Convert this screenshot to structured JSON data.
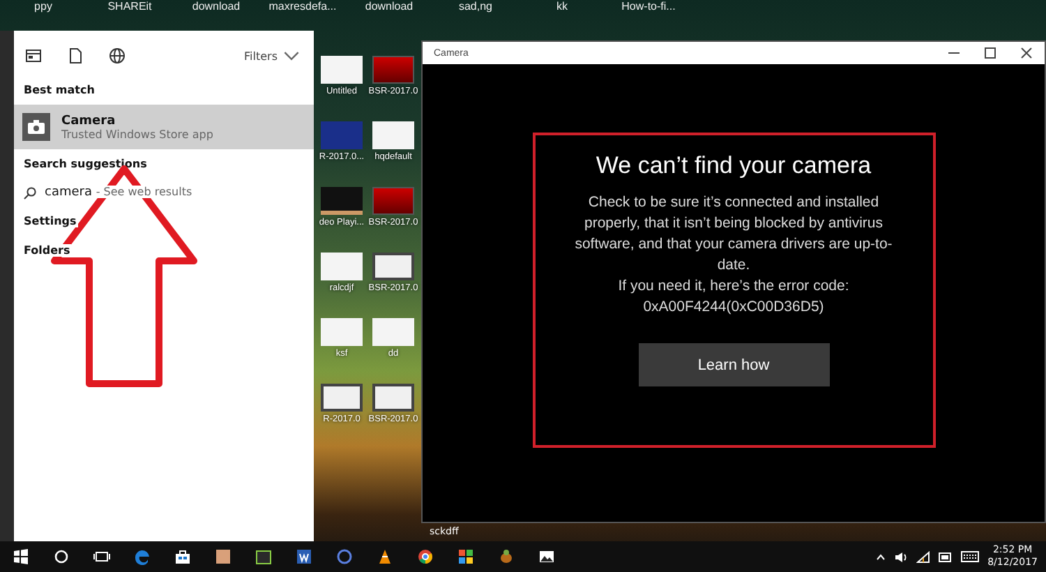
{
  "desktop": {
    "top_labels": [
      "ppy",
      "SHAREit",
      "download",
      "maxresdefa...",
      "download",
      "sad,ng",
      "kk",
      "How-to-fi..."
    ],
    "icons": [
      {
        "label": "Untitled",
        "kind": "doc"
      },
      {
        "label": "BSR-2017.0",
        "kind": "red"
      },
      {
        "label": "R-2017.0...",
        "kind": "blue"
      },
      {
        "label": "hqdefault",
        "kind": "doc"
      },
      {
        "label": "deo Playi...",
        "kind": "dark"
      },
      {
        "label": "BSR-2017.0",
        "kind": "red"
      },
      {
        "label": "ralcdjf",
        "kind": "doc"
      },
      {
        "label": "BSR-2017.0",
        "kind": "film"
      },
      {
        "label": "ksf",
        "kind": "doc"
      },
      {
        "label": "dd",
        "kind": "doc"
      },
      {
        "label": "R-2017.0",
        "kind": "film"
      },
      {
        "label": "BSR-2017.0",
        "kind": "film"
      }
    ],
    "stray_label": "sckdff"
  },
  "start_menu": {
    "filters": "Filters",
    "best_match_heading": "Best match",
    "result": {
      "title": "Camera",
      "subtitle": "Trusted Windows Store app",
      "selected": true
    },
    "suggestions_heading": "Search suggestions",
    "suggestion": {
      "query": "camera",
      "hint": "- See web results"
    },
    "sections": [
      "Settings",
      "Folders"
    ]
  },
  "camera_window": {
    "title": "Camera",
    "heading": "We can’t find your camera",
    "message": "Check to be sure it’s connected and installed properly, that it isn’t being blocked by antivirus software, and that your camera drivers are up-to-date.",
    "error_intro": "If you need it, here’s the error code:",
    "error_code": "0xA00F4244(0xC00D36D5)",
    "button": "Learn how"
  },
  "taskbar": {
    "apps": [
      {
        "kind": "edge"
      },
      {
        "kind": "store"
      },
      {
        "kind": "tan"
      },
      {
        "kind": "green"
      },
      {
        "kind": "word"
      },
      {
        "kind": "blue"
      },
      {
        "kind": "vlc"
      },
      {
        "kind": "chrome"
      },
      {
        "kind": "tiles"
      },
      {
        "kind": "bug"
      },
      {
        "kind": "photos"
      }
    ],
    "time": "2:52 PM",
    "date": "8/12/2017"
  }
}
